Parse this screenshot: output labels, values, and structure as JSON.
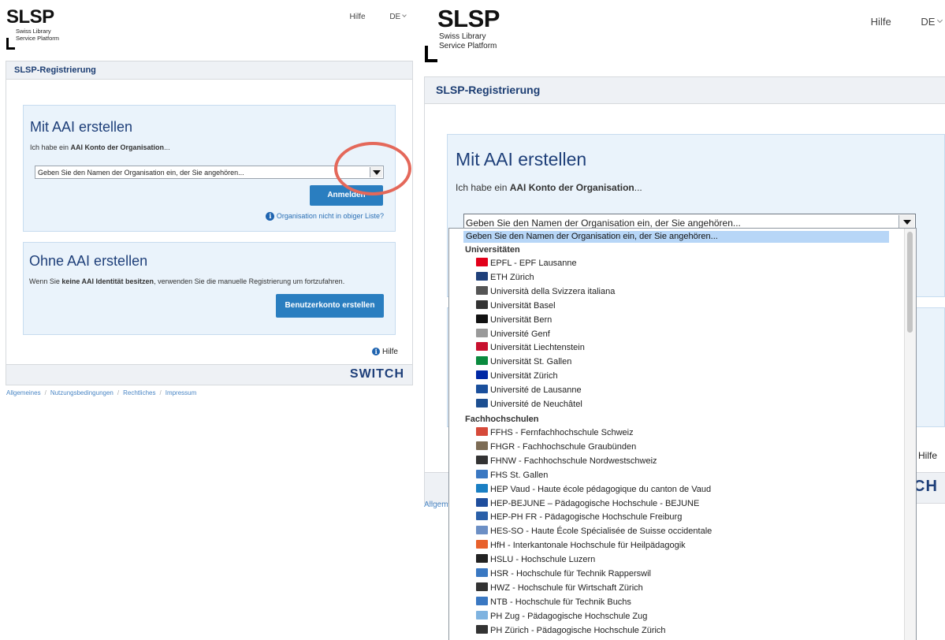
{
  "left": {
    "logo": {
      "title": "SLSP",
      "sub1": "Swiss Library",
      "sub2": "Service Platform"
    },
    "nav": {
      "help": "Hilfe",
      "lang": "DE"
    },
    "header": "SLSP-Registrierung",
    "aai": {
      "title": "Mit AAI erstellen",
      "desc_pre": "Ich habe ein ",
      "desc_bold": "AAI Konto der Organisation",
      "desc_post": "...",
      "select_placeholder": "Geben Sie den Namen der Organisation ein, der Sie angehören...",
      "login_button": "Anmelden",
      "not_listed": "Organisation nicht in obiger Liste?"
    },
    "noaai": {
      "title": "Ohne AAI erstellen",
      "desc_pre": "Wenn Sie ",
      "desc_bold": "keine AAI Identität besitzen",
      "desc_post": ", verwenden Sie die manuelle Registrierung um fortzufahren.",
      "create_button": "Benutzerkonto erstellen"
    },
    "help_link": "Hilfe",
    "brand": "SWITCH",
    "footer": [
      "Allgemeines",
      "Nutzungsbedingungen",
      "Rechtliches",
      "Impressum"
    ]
  },
  "right": {
    "logo": {
      "title": "SLSP",
      "sub1": "Swiss Library",
      "sub2": "Service Platform"
    },
    "nav": {
      "help": "Hilfe",
      "lang": "DE"
    },
    "header": "SLSP-Registrierung",
    "aai": {
      "title": "Mit AAI erstellen",
      "desc_pre": "Ich habe ein ",
      "desc_bold": "AAI Konto der Organisation",
      "desc_post": "...",
      "select_value": "Geben Sie den Namen der Organisation ein, der Sie angehören..."
    },
    "peek": {
      "letter": "O",
      "w": "W",
      "hilfe": "Hilfe",
      "brand_end": "CH",
      "footer_start": "Allgemein"
    },
    "dropdown": {
      "selected": "Geben Sie den Namen der Organisation ein, der Sie angehören...",
      "group1": "Universitäten",
      "universities": [
        {
          "label": "EPFL - EPF Lausanne",
          "color": "#e2001a",
          "icon": "epfl-logo-icon"
        },
        {
          "label": "ETH Zürich",
          "color": "#1f407a",
          "icon": "eth-logo-icon"
        },
        {
          "label": "Università della Svizzera italiana",
          "color": "#555555",
          "icon": "usi-logo-icon"
        },
        {
          "label": "Universität Basel",
          "color": "#333333",
          "icon": "basel-logo-icon"
        },
        {
          "label": "Universität Bern",
          "color": "#111111",
          "icon": "bern-logo-icon"
        },
        {
          "label": "Université Genf",
          "color": "#9a9a9a",
          "icon": "geneva-logo-icon"
        },
        {
          "label": "Universität Liechtenstein",
          "color": "#c8102e",
          "icon": "liechtenstein-logo-icon"
        },
        {
          "label": "Universität St. Gallen",
          "color": "#0a8a3e",
          "icon": "stgallen-logo-icon"
        },
        {
          "label": "Universität Zürich",
          "color": "#0028a5",
          "icon": "uzh-logo-icon"
        },
        {
          "label": "Université de Lausanne",
          "color": "#1a4f9c",
          "icon": "unil-logo-icon"
        },
        {
          "label": "Université de Neuchâtel",
          "color": "#1d4f91",
          "icon": "unine-logo-icon"
        }
      ],
      "group2": "Fachhochschulen",
      "fachhochschulen": [
        {
          "label": "FFHS - Fernfachhochschule Schweiz",
          "color": "#d64a3a",
          "icon": "ffhs-logo-icon"
        },
        {
          "label": "FHGR - Fachhochschule Graubünden",
          "color": "#7d6c55",
          "icon": "fhgr-logo-icon"
        },
        {
          "label": "FHNW - Fachhochschule Nordwestschweiz",
          "color": "#333333",
          "icon": "fhnw-logo-icon"
        },
        {
          "label": "FHS St. Gallen",
          "color": "#3a78c2",
          "icon": "fhs-logo-icon"
        },
        {
          "label": "HEP Vaud - Haute école pédagogique du canton de Vaud",
          "color": "#1a7fc3",
          "icon": "hep-vaud-logo-icon"
        },
        {
          "label": "HEP-BEJUNE – Pädagogische Hochschule - BEJUNE",
          "color": "#1f4e9d",
          "icon": "hep-bejune-logo-icon"
        },
        {
          "label": "HEP-PH FR - Pädagogische Hochschule Freiburg",
          "color": "#2a5fa8",
          "icon": "hep-ph-fr-logo-icon"
        },
        {
          "label": "HES-SO - Haute École Spécialisée de Suisse occidentale",
          "color": "#6c8fc5",
          "icon": "hes-so-logo-icon"
        },
        {
          "label": "HfH - Interkantonale Hochschule für Heilpädagogik",
          "color": "#e8612c",
          "icon": "hfh-logo-icon"
        },
        {
          "label": "HSLU - Hochschule Luzern",
          "color": "#222222",
          "icon": "hslu-logo-icon"
        },
        {
          "label": "HSR - Hochschule für Technik Rapperswil",
          "color": "#3a78c2",
          "icon": "hsr-logo-icon"
        },
        {
          "label": "HWZ - Hochschule für Wirtschaft Zürich",
          "color": "#333333",
          "icon": "hwz-logo-icon"
        },
        {
          "label": "NTB - Hochschule für Technik Buchs",
          "color": "#3a78c2",
          "icon": "ntb-logo-icon"
        },
        {
          "label": "PH Zug - Pädagogische Hochschule Zug",
          "color": "#7fb3e0",
          "icon": "ph-zug-logo-icon"
        },
        {
          "label": "PH Zürich - Pädagogische Hochschule Zürich",
          "color": "#333333",
          "icon": "ph-zurich-logo-icon"
        }
      ]
    }
  },
  "colors": {
    "accent": "#2a7ec0",
    "title_blue": "#1e3f79",
    "card_bg": "#eaf3fb",
    "annotation": "#e4685a",
    "selected_bg": "#b7d6f7"
  }
}
